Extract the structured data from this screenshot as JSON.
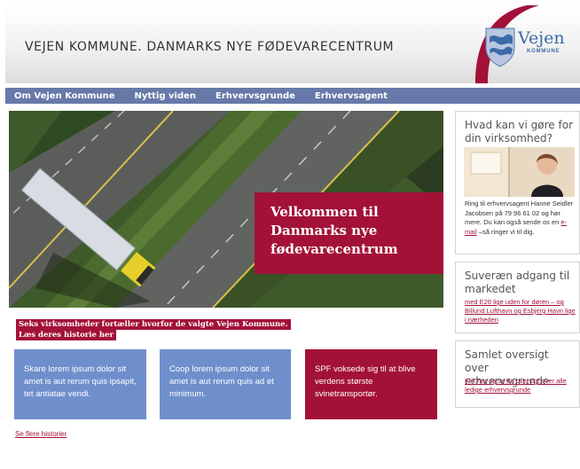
{
  "header": {
    "title": "VEJEN KOMMUNE. DANMARKS NYE FØDEVARECENTRUM",
    "logo_name": "Vejen",
    "logo_sub": "KOMMUNE"
  },
  "nav": {
    "items": [
      "Om Vejen Kommune",
      "Nyttig viden",
      "Erhvervsgrunde",
      "Erhvervsagent"
    ]
  },
  "hero": {
    "line1": "Velkommen til",
    "line2": "Danmarks nye",
    "line3": "fødevarecentrum"
  },
  "banner": {
    "line1": "Seks virksomheder fortæller hvorfor de valgte Vejen Kommune.",
    "line2": "Læs deres historie her"
  },
  "stories": [
    {
      "text": "Skare lorem ipsum dolor sit amet is aut rerum quis ipsapit, tet antiatae vendi."
    },
    {
      "text": "Coop lorem ipsum dolor sit amet is aut rerum quis ad et minimum."
    },
    {
      "text": "SPF voksede sig til at blive verdens største svinetransportør."
    }
  ],
  "more_link": "Se flere historier",
  "sidebar": {
    "box1": {
      "title": "Hvad kan vi gøre for din virksomhed?",
      "body_before": "Ring til erhvervsagent Hanne Seidler Jacobsen på 79 96 61 02 og hør mere. Du kan også sende os en ",
      "email_link": "e-mail",
      "body_after": " –så ringer vi til dig."
    },
    "box2": {
      "title": "Suveræn adgang til markedet",
      "link": "med E20 lige uden for døren – og Billund Lufthavn og Esbjerg Havn lige i nærheden"
    },
    "box3": {
      "title": "Samlet oversigt over erhvervsgrunde",
      "link": "Klik her og se en oversigt over alle ledige erhvervsgrunde"
    }
  },
  "colors": {
    "accent": "#a31138",
    "nav": "#6679a8",
    "story_blue": "#6f8fcc",
    "brand_blue": "#3c6aa8"
  }
}
